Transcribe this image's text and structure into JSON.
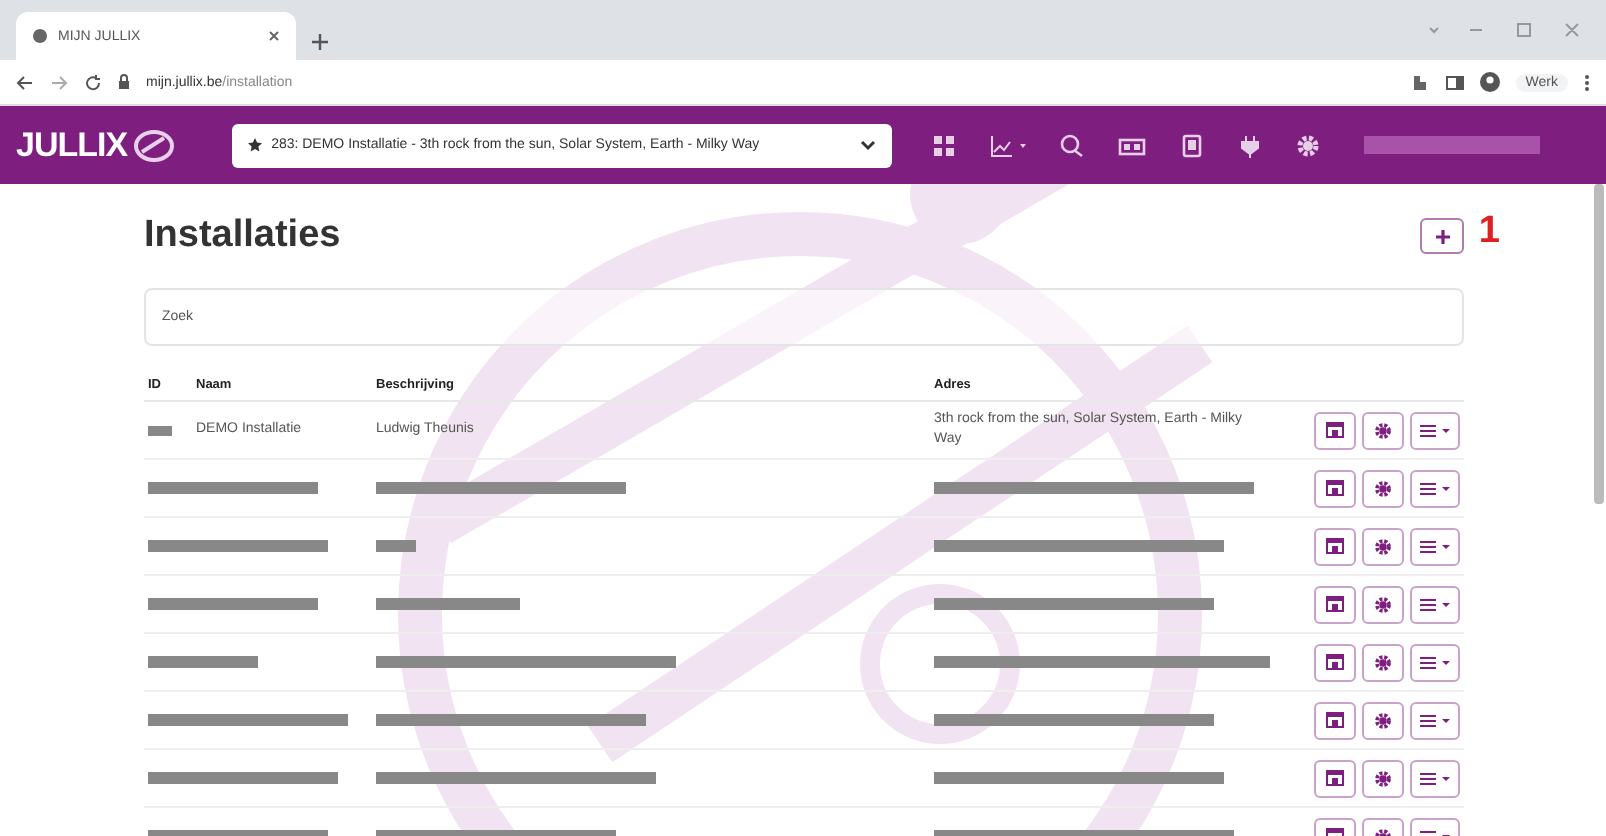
{
  "browser": {
    "tab_title": "MIJN JULLIX",
    "url_host": "mijn.jullix.be",
    "url_path": "/installation",
    "profile": "Werk"
  },
  "nav": {
    "logo": "JULLIX",
    "installation_selector": "283: DEMO Installatie - 3th rock from the sun, Solar System, Earth - Milky Way"
  },
  "page": {
    "title": "Installaties",
    "annotation": "1",
    "search": {
      "placeholder": "Zoek"
    },
    "columns": [
      "ID",
      "Naam",
      "Beschrijving",
      "Adres"
    ],
    "rows": [
      {
        "kind": "text",
        "name": "DEMO Installatie",
        "description": "Ludwig Theunis",
        "address": "3th rock from the sun, Solar System, Earth - Milky Way"
      },
      {
        "kind": "redacted"
      },
      {
        "kind": "redacted"
      },
      {
        "kind": "redacted"
      },
      {
        "kind": "redacted"
      },
      {
        "kind": "redacted"
      },
      {
        "kind": "redacted"
      },
      {
        "kind": "redacted"
      }
    ]
  }
}
